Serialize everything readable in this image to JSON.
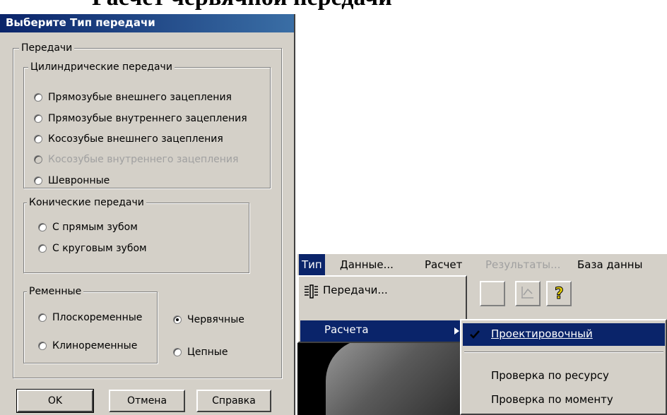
{
  "document": {
    "heading": "Расчет червячной передачи"
  },
  "dialog": {
    "title": "Выберите Тип передачи",
    "group_main": "Передачи",
    "cylindrical": {
      "label": "Цилиндрические передачи",
      "options": [
        "Прямозубые внешнего зацепления",
        "Прямозубые внутреннего зацепления",
        "Косозубые внешнего зацепления",
        "Косозубые внутреннего зацепления",
        "Шевронные"
      ]
    },
    "conical": {
      "label": "Конические передачи",
      "options": [
        "С прямым зубом",
        "С круговым зубом"
      ]
    },
    "belt": {
      "label": "Ременные",
      "options": [
        "Плоскоременные",
        "Клиноременные"
      ]
    },
    "worm_label": "Червячные",
    "chain_label": "Цепные",
    "buttons": {
      "ok": "OK",
      "cancel": "Отмена",
      "help": "Справка"
    }
  },
  "app": {
    "menu": [
      "Тип",
      "Данные...",
      "Расчет",
      "Результаты...",
      "База данны"
    ],
    "dropdown": {
      "item1": "Передачи...",
      "item2": "Расчета"
    },
    "submenu": {
      "item1": "Проектировочный",
      "item2": "Проверка по ресурсу",
      "item3": "Проверка по моменту"
    }
  }
}
